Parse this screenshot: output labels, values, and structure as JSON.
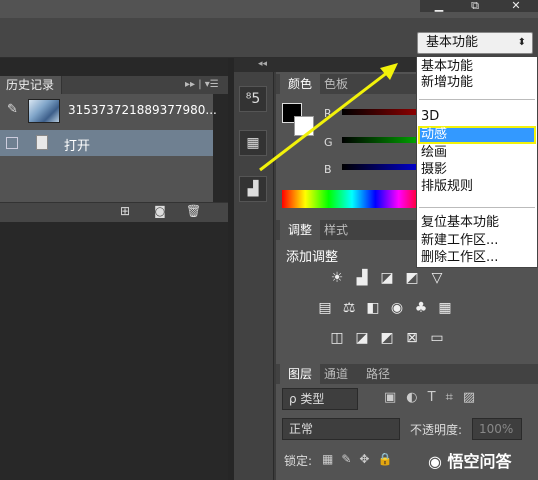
{
  "window": {
    "min_label": "▁",
    "restore_label": "⧉",
    "close_label": "✕"
  },
  "workspace_select": {
    "value": "基本功能",
    "arrow": "⬍"
  },
  "history": {
    "tab_label": "历史记录",
    "menu_glyph": "▸▸ | ▾☰",
    "snapshot_label": "315373721889377980...",
    "open_label": "打开"
  },
  "tool_icons": [
    "⁸5",
    "▦",
    "▟"
  ],
  "color_panel": {
    "tabs": [
      "颜色",
      "色板"
    ],
    "channels": [
      "R",
      "G",
      "B"
    ]
  },
  "adjust_panel": {
    "tabs": [
      "调整",
      "样式"
    ],
    "title": "添加调整",
    "row1": [
      "☀",
      "▟",
      "◪",
      "◩",
      "▽"
    ],
    "row2": [
      "▤",
      "⚖",
      "◧",
      "◉",
      "♣",
      "▦"
    ],
    "row3": [
      "◫",
      "◪",
      "◩",
      "⊠",
      "▭"
    ]
  },
  "layers_panel": {
    "tabs": [
      "图层",
      "通道",
      "路径"
    ],
    "filter_label": "ρ 类型",
    "blend_value": "正常",
    "opacity_label": "不透明度:",
    "opacity_value": "100%",
    "lock_label": "锁定:"
  },
  "dropdown": {
    "items": [
      "基本功能",
      "新增功能",
      "3D",
      "动感",
      "绘画",
      "摄影",
      "排版规则",
      "复位基本功能",
      "新建工作区...",
      "删除工作区..."
    ],
    "selected": "动感"
  },
  "watermark": "悟空问答",
  "colors": {
    "arrow": "#f2f20a",
    "selection": "#3399ff",
    "panel": "#535353"
  }
}
